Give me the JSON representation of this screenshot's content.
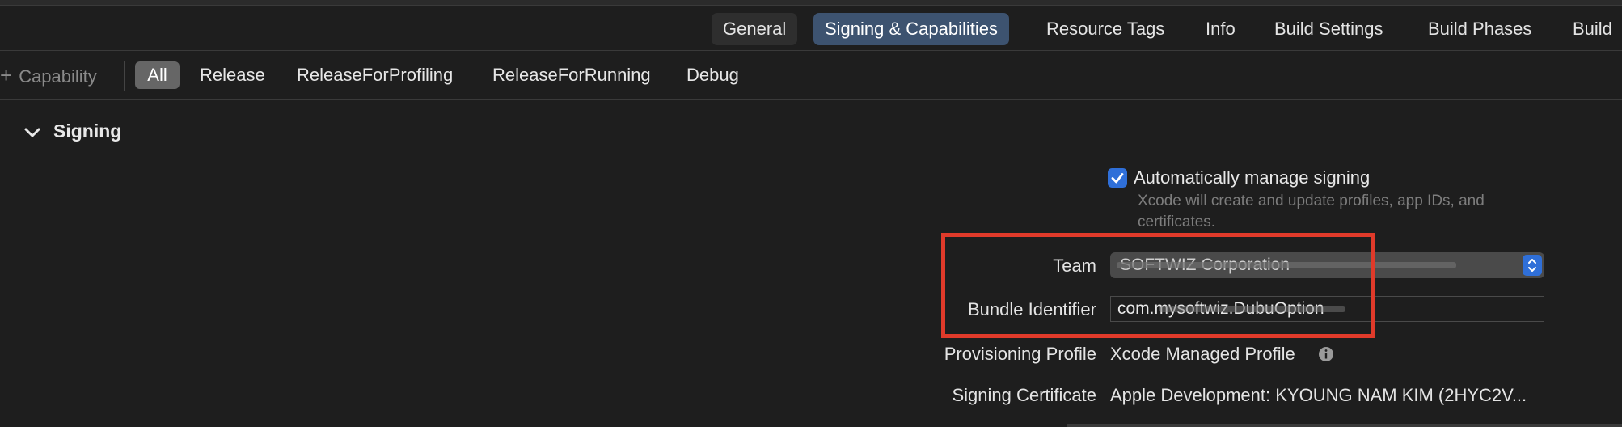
{
  "tabs": {
    "general": "General",
    "signing_capabilities": "Signing & Capabilities",
    "resource_tags": "Resource Tags",
    "info": "Info",
    "build_settings": "Build Settings",
    "build_phases": "Build Phases",
    "build_rules": "Build"
  },
  "filterbar": {
    "add_capability": "Capability",
    "configs": [
      "All",
      "Release",
      "ReleaseForProfiling",
      "ReleaseForRunning",
      "Debug"
    ],
    "selected": "All"
  },
  "signing": {
    "section_title": "Signing",
    "auto_manage_label": "Automatically manage signing",
    "auto_manage_checked": true,
    "auto_manage_desc": "Xcode will create and update profiles, app IDs, and certificates.",
    "team_label": "Team",
    "team_value": "SOFTWIZ Corporation",
    "bundle_label": "Bundle Identifier",
    "bundle_value": "com.mysoftwiz.DubuOption",
    "prov_label": "Provisioning Profile",
    "prov_value": "Xcode Managed Profile",
    "cert_label": "Signing Certificate",
    "cert_value": "Apple Development: KYOUNG NAM KIM (2HYC2V..."
  },
  "colors": {
    "accent": "#2f6fd8",
    "active_tab": "#3d5370",
    "highlight": "#e03a2a"
  },
  "icons": {
    "checkbox": "checkmark-icon",
    "chevron": "chevron-down-icon",
    "stepper": "up-down-chevron-icon",
    "info": "info-circle-icon",
    "plus": "plus-icon"
  }
}
